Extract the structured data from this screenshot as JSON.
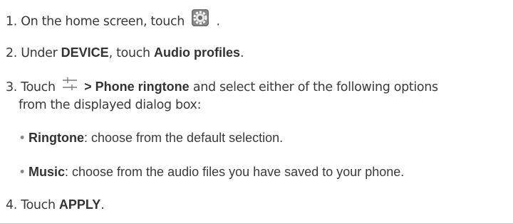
{
  "steps": {
    "s1": {
      "prefix": "1. On the home screen, touch",
      "suffix": ".",
      "icon": "settings-gear-icon"
    },
    "s2": {
      "prefix": "2. Under",
      "bold1": "DEVICE",
      "mid": ", touch",
      "bold2": "Audio profiles",
      "suffix": "."
    },
    "s3": {
      "prefix": "3. Touch",
      "icon": "sliders-icon",
      "bold": "> Phone ringtone",
      "rest": "and select either of the following options",
      "cont": "from the displayed dialog box:"
    },
    "o1": {
      "bullet": "•",
      "bold": "Ringtone",
      "rest": ": choose from the default selection."
    },
    "o2": {
      "bullet": "•",
      "bold": "Music",
      "rest": ": choose from the audio files you have saved to your phone."
    },
    "s4": {
      "prefix": "4. Touch",
      "bold": "APPLY",
      "suffix": "."
    }
  }
}
